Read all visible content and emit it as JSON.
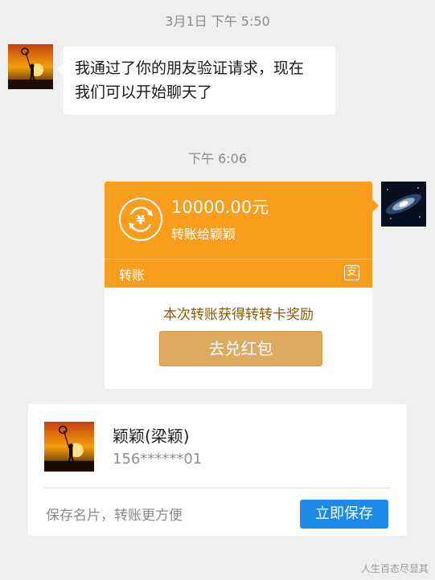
{
  "timestamps": [
    "3月1日 下午 5:50",
    "下午 6:06"
  ],
  "incoming_message": {
    "lines": [
      "我通过了你的朋友验证请求，现在",
      "我们可以开始聊天了"
    ]
  },
  "transfer": {
    "amount": "10000.00元",
    "recipient": "转账给颖颖",
    "label": "转账",
    "reward_text": "本次转账获得转转卡奖励",
    "redeem_button": "去兑红包",
    "accent_color": "#f99d1c"
  },
  "contact_card": {
    "name": "颖颖(梁颖)",
    "phone": "156******01",
    "hint": "保存名片，转账更方便",
    "save_button": "立即保存",
    "button_color": "#1d8ae8"
  },
  "watermark": "人生百态尽显其"
}
